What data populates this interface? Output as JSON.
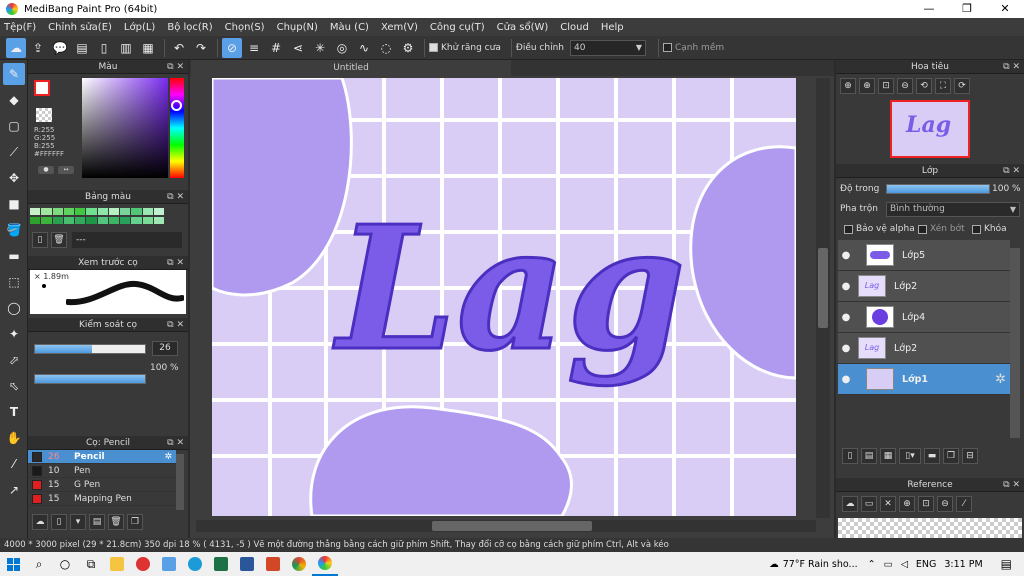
{
  "window": {
    "title": "MediBang Paint Pro (64bit)",
    "minimize": "—",
    "restore": "❐",
    "close": "✕"
  },
  "menu": [
    "Tệp(F)",
    "Chỉnh sửa(E)",
    "Lớp(L)",
    "Bộ lọc(R)",
    "Chọn(S)",
    "Chụp(N)",
    "Màu (C)",
    "Xem(V)",
    "Công cụ(T)",
    "Cửa sổ(W)",
    "Cloud",
    "Help"
  ],
  "toolbar": {
    "antialias_label": "Khử răng cưa",
    "adjust_label": "Điều chỉnh",
    "adjust_value": "40",
    "soft_edge_label": "Cạnh mềm"
  },
  "color_panel": {
    "title": "Màu",
    "r": "R:255",
    "g": "G:255",
    "b": "B:255",
    "hex": "#FFFFFF"
  },
  "palette_panel": {
    "title": "Bảng màu",
    "value": "---"
  },
  "brush_preview": {
    "title": "Xem trước cọ",
    "size": "1.89m"
  },
  "brush_control": {
    "title": "Kiểm soát cọ",
    "size": "26",
    "opacity": "100 %",
    "size_fraction": 0.52,
    "opacity_fraction": 1.0
  },
  "brush_list": {
    "title": "Cọ: Pencil",
    "items": [
      {
        "size": "26",
        "name": "Pencil",
        "color": "#2a2a2a"
      },
      {
        "size": "10",
        "name": "Pen",
        "color": "#1a1a1a"
      },
      {
        "size": "15",
        "name": "G Pen",
        "color": "#e02020"
      },
      {
        "size": "15",
        "name": "Mapping Pen",
        "color": "#e02020"
      }
    ]
  },
  "canvas": {
    "tab": "Untitled",
    "text": "Lag",
    "bg": "#d9cdf6",
    "blob": "#b09af0",
    "letter": "#7b5ce8"
  },
  "navigator": {
    "title": "Hoa tiêu"
  },
  "layer_panel": {
    "title": "Lớp",
    "opacity_label": "Độ trong",
    "opacity_value": "100 %",
    "opacity_fraction": 1.0,
    "blend_label": "Pha trộn",
    "blend_value": "Bình thường",
    "protect_alpha": "Bảo vệ alpha",
    "clip": "Xén bớt",
    "lock": "Khóa",
    "layers": [
      {
        "name": "Lớp5",
        "thumb": "blob"
      },
      {
        "name": "Lớp2",
        "thumb": "text"
      },
      {
        "name": "Lớp4",
        "thumb": "circle"
      },
      {
        "name": "Lớp2",
        "thumb": "text"
      },
      {
        "name": "Lớp1",
        "thumb": "bg"
      }
    ]
  },
  "reference": {
    "title": "Reference"
  },
  "status": {
    "text": "4000 * 3000 pixel   (29 * 21.8cm)   350 dpi   18 %   ( 4131, -5 )   Vẽ một đường thẳng bằng cách giữ phím Shift, Thay đổi cỡ cọ bằng cách giữ phím Ctrl, Alt và kéo"
  },
  "taskbar": {
    "weather": "77°F  Rain sho...",
    "lang": "ENG",
    "time": "3:11 PM"
  }
}
